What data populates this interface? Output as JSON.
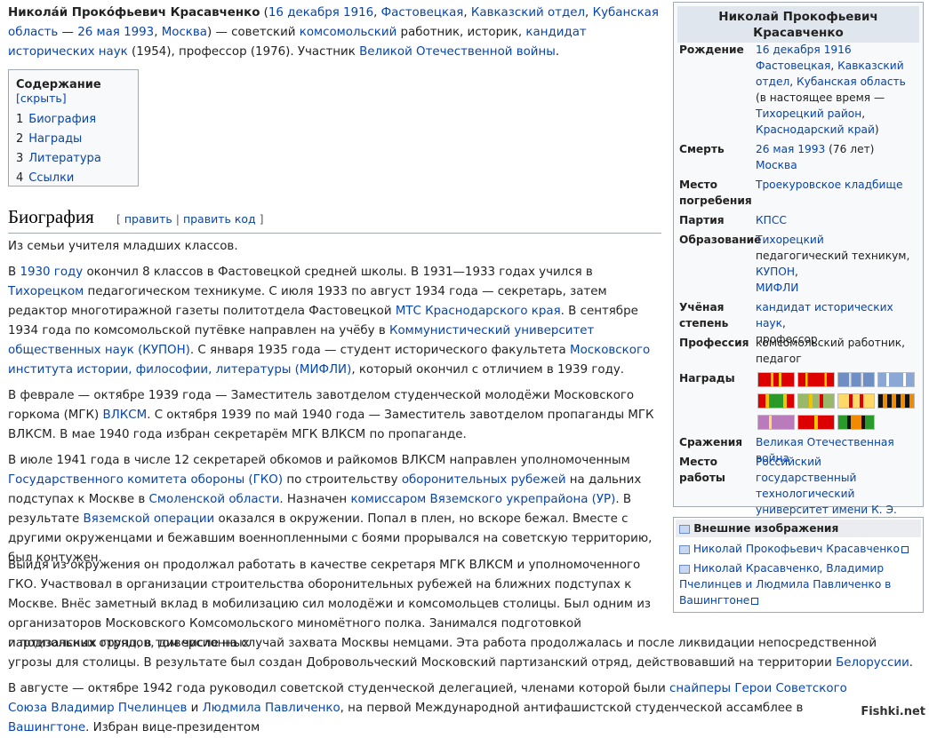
{
  "lead": {
    "name": "Никола́й Проко́фьевич Красавченко",
    "paren_open": " (",
    "birth_date": "16 декабря 1916",
    "sep1": ", ",
    "birth_place1": "Фастовецкая",
    "sep2": ", ",
    "birth_place2": "Кавказский отдел",
    "sep3": ", ",
    "birth_place3": "Кубанская область",
    "dash": " — ",
    "death_date": "26 мая 1993",
    "sep4": ", ",
    "death_place": "Москва",
    "t1": ") — советский ",
    "komsomol": "комсомольский",
    "t2": " работник, историк, ",
    "degree": "кандидат исторических наук",
    "t3": " (1954), профессор (1976). Участник ",
    "war": "Великой Отечественной войны",
    "t4": "."
  },
  "toc": {
    "title": "Содержание",
    "hide": "[скрыть]",
    "items": [
      {
        "num": "1",
        "label": "Биография"
      },
      {
        "num": "2",
        "label": "Награды"
      },
      {
        "num": "3",
        "label": "Литература"
      },
      {
        "num": "4",
        "label": "Ссылки"
      }
    ]
  },
  "section": {
    "title": "Биография",
    "edit_open": "[ ",
    "edit": "править",
    "edit_sep": " | ",
    "edit_code": "править код",
    "edit_close": " ]"
  },
  "paragraphs": {
    "p1": "Из семьи учителя младших классов.",
    "p2": {
      "a": "В ",
      "l1": "1930 году",
      "b": " окончил 8 классов в Фастовецкой средней школы. В 1931—1933 годах учился в ",
      "l2": "Тихорецком",
      "c": " педагогическом техникуме. С июля 1933 по август 1934 года — секретарь, затем редактор многотиражной газеты политотдела Фастовецкой ",
      "l3": "МТС Краснодарского края",
      "d": ". В сентябре 1934 года по комсомольской путёвке направлен на учёбу в ",
      "l4": "Коммунистический университет общественных наук (КУПОН)",
      "e": ". С января 1935 года — студент исторического факультета ",
      "l5": "Московского института истории, философии, литературы (МИФЛИ)",
      "f": ", который окончил с отличием в 1939 году."
    },
    "p3": {
      "a": "В феврале — октябре 1939 года — Заместитель завотделом студенческой молодёжи Московского горкома (МГК) ",
      "l1": "ВЛКСМ",
      "b": ". С октября 1939 по май 1940 года — Заместитель завотделом пропаганды МГК ВЛКСМ. В мае 1940 года избран секретарём МГК ВЛКСМ по пропаганде."
    },
    "p4": {
      "a": "В июле 1941 года в числе 12 секретарей обкомов и райкомов ВЛКСМ направлен уполномоченным ",
      "l1": "Государственного комитета обороны (ГКО)",
      "b": " по строительству ",
      "l2": "оборонительных рубежей",
      "c": " на дальних подступах к Москве в ",
      "l3": "Смоленской области",
      "d": ". Назначен ",
      "l4": "комиссаром Вяземского укрепрайона (УР)",
      "e": ". В результате ",
      "l5": "Вяземской операции",
      "f": " оказался в окружении. Попал в плен, но вскоре бежал. Вместе с другими окруженцами и бежавшим военнопленными с боями прорывался на советскую территорию, был контужен."
    },
    "p5a": "Выйдя из окружения он продолжал работать в качестве секретаря МГК ВЛКСМ и уполномоченного ГКО. Участвовал в организации строительства оборонительных рубежей на ближних подступах к Москве. Внёс заметный вклад в мобилизацию сил молодёжи и комсомольцев столицы. Был одним из организаторов Московского Комсомольского миномётного полка. Занимался подготовкой партизанских отрядов, диверсионных",
    "p5b": {
      "a": "и подпольных групп, в том числе на случай захвата Москвы немцами. Эта работа продолжалась и после ликвидации непосредственной угрозы для столицы. В результате был создан Добровольческий Московский партизанский отряд, действовавший на территории ",
      "l1": "Белоруссии",
      "b": "."
    },
    "p6": {
      "a": "В августе — октябре 1942 года руководил советской студенческой делегацией, членами которой были ",
      "l1": "снайперы",
      "b": " ",
      "l2": "Герои Советского Союза",
      "c": " ",
      "l3": "Владимир Пчелинцев",
      "d": " и ",
      "l4": "Людмила Павличенко",
      "e": ", на первой Международной антифашистской студенческой ассамблее в ",
      "l5": "Вашингтоне",
      "f": ". Избран вице-президентом"
    }
  },
  "infobox": {
    "title": "Николай Прокофьевич Красавченко",
    "birth": {
      "label": "Рождение",
      "date": "16 декабря 1916",
      "place1": "Фастовецкая",
      "place2": "Кавказский отдел",
      "place3": "Кубанская область",
      "now": " (в настоящее время — ",
      "now_l1": "Тихорецкий район",
      "now_l2": "Краснодарский край",
      "close": ")"
    },
    "death": {
      "label": "Смерть",
      "date": "26 мая 1993",
      "age": " (76 лет)",
      "place": "Москва"
    },
    "burial": {
      "label": "Место погребения",
      "value": "Троекуровское кладбище"
    },
    "party": {
      "label": "Партия",
      "value": "КПСС"
    },
    "education": {
      "label": "Образование",
      "l1": "Тихорецкий",
      "t1": " педагогический техникум,",
      "l2": "КУПОН",
      "l3": "МИФЛИ"
    },
    "degree": {
      "label": "Учёная степень",
      "l1": "кандидат исторических наук",
      "t1": ",",
      "t2": "профессор"
    },
    "profession": {
      "label": "Профессия",
      "value": "комсомольский работник, педагог"
    },
    "awards": {
      "label": "Награды"
    },
    "battles": {
      "label": "Сражения",
      "value": "Великая Отечественная война"
    },
    "work": {
      "label": "Место работы",
      "value": "Российский государственный технологический университет имени К. Э. Циолковского"
    }
  },
  "external": {
    "title": "Внешние изображения",
    "items": [
      "Николай Прокофьевич Красавченко",
      "Николай Красавченко, Владимир Пчелинцев и Людмила Павличенко в Вашингтоне"
    ]
  },
  "watermark": "Fishki.net",
  "colors": {
    "link": "#0645ad",
    "infobox_bg": "#f8f9fa",
    "title_bg": "#e0e6ed",
    "border": "#a2a9b1"
  }
}
